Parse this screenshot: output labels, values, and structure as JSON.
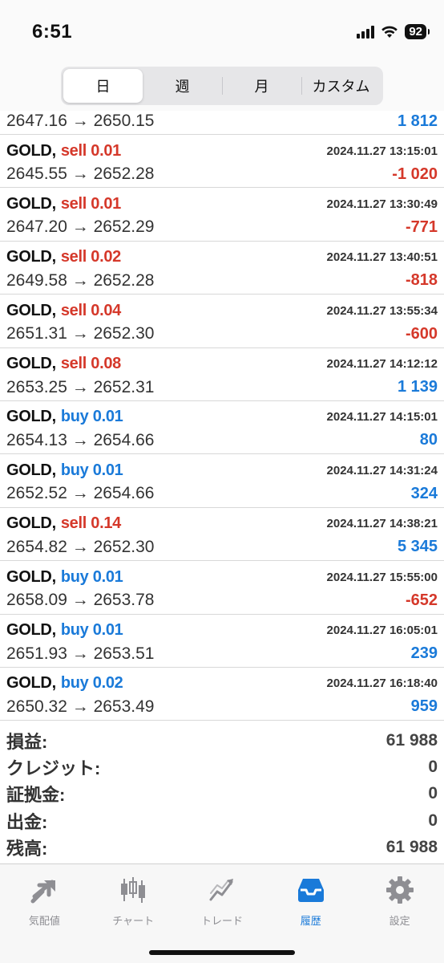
{
  "status": {
    "time": "6:51",
    "battery": "92"
  },
  "segments": [
    {
      "label": "日"
    },
    {
      "label": "週"
    },
    {
      "label": "月"
    },
    {
      "label": "カスタム"
    }
  ],
  "partial_row": {
    "prices": "2647.16 → 2650.15",
    "profit": "1 812"
  },
  "trades": [
    {
      "symbol": "GOLD,",
      "side": "sell 0.01",
      "datetime": "2024.11.27 13:15:01",
      "prices": "2645.55 → 2652.28",
      "profit": "-1 020"
    },
    {
      "symbol": "GOLD,",
      "side": "sell 0.01",
      "datetime": "2024.11.27 13:30:49",
      "prices": "2647.20 → 2652.29",
      "profit": "-771"
    },
    {
      "symbol": "GOLD,",
      "side": "sell 0.02",
      "datetime": "2024.11.27 13:40:51",
      "prices": "2649.58 → 2652.28",
      "profit": "-818"
    },
    {
      "symbol": "GOLD,",
      "side": "sell 0.04",
      "datetime": "2024.11.27 13:55:34",
      "prices": "2651.31 → 2652.30",
      "profit": "-600"
    },
    {
      "symbol": "GOLD,",
      "side": "sell 0.08",
      "datetime": "2024.11.27 14:12:12",
      "prices": "2653.25 → 2652.31",
      "profit": "1 139"
    },
    {
      "symbol": "GOLD,",
      "side": "buy 0.01",
      "datetime": "2024.11.27 14:15:01",
      "prices": "2654.13 → 2654.66",
      "profit": "80"
    },
    {
      "symbol": "GOLD,",
      "side": "buy 0.01",
      "datetime": "2024.11.27 14:31:24",
      "prices": "2652.52 → 2654.66",
      "profit": "324"
    },
    {
      "symbol": "GOLD,",
      "side": "sell 0.14",
      "datetime": "2024.11.27 14:38:21",
      "prices": "2654.82 → 2652.30",
      "profit": "5 345"
    },
    {
      "symbol": "GOLD,",
      "side": "buy 0.01",
      "datetime": "2024.11.27 15:55:00",
      "prices": "2658.09 → 2653.78",
      "profit": "-652"
    },
    {
      "symbol": "GOLD,",
      "side": "buy 0.01",
      "datetime": "2024.11.27 16:05:01",
      "prices": "2651.93 → 2653.51",
      "profit": "239"
    },
    {
      "symbol": "GOLD,",
      "side": "buy 0.02",
      "datetime": "2024.11.27 16:18:40",
      "prices": "2650.32 → 2653.49",
      "profit": "959"
    }
  ],
  "summary": [
    {
      "label": "損益:",
      "value": "61 988"
    },
    {
      "label": "クレジット:",
      "value": "0"
    },
    {
      "label": "証拠金:",
      "value": "0"
    },
    {
      "label": "出金:",
      "value": "0"
    },
    {
      "label": "残高:",
      "value": "61 988"
    }
  ],
  "tabbar": [
    {
      "label": "気配値",
      "icon": "quotes-icon"
    },
    {
      "label": "チャート",
      "icon": "chart-icon"
    },
    {
      "label": "トレード",
      "icon": "trade-icon"
    },
    {
      "label": "履歴",
      "icon": "history-icon"
    },
    {
      "label": "設定",
      "icon": "settings-icon"
    }
  ],
  "colors": {
    "sell": "#d5382a",
    "buy": "#1a7ad9",
    "active_tab": "#1a7ad9",
    "inactive": "#8e8e93"
  }
}
